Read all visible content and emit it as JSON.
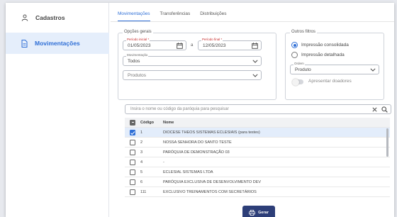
{
  "sidebar": {
    "items": [
      {
        "label": "Cadastros",
        "icon": "person-icon"
      },
      {
        "label": "Movimentações",
        "icon": "document-icon",
        "active": true
      }
    ]
  },
  "tabs": [
    {
      "label": "Movimentações",
      "active": true
    },
    {
      "label": "Transferências"
    },
    {
      "label": "Distribuições"
    }
  ],
  "general": {
    "legend": "Opções gerais",
    "start_label": "Período inicial *",
    "start_value": "01/05/2023",
    "range_sep": "a",
    "end_label": "Período final *",
    "end_value": "12/05/2023",
    "movement_label": "Movimentação",
    "movement_value": "Todos",
    "products_value": "Produtos"
  },
  "other": {
    "legend": "Outros filtros",
    "radio_consolidated": "Impressão consolidada",
    "radio_detailed": "Impressão detalhada",
    "order_label": "Ordem",
    "order_value": "Produto",
    "toggle_label": "Apresentar doadores"
  },
  "search": {
    "placeholder": "Insira o nome ou código da paróquia para pesquisar"
  },
  "table": {
    "headers": [
      "Código",
      "Nome"
    ],
    "rows": [
      {
        "code": "1",
        "name": "DIOCESE THEOS SISTEMAS ECLESIAIS (para testes)",
        "checked": true
      },
      {
        "code": "2",
        "name": "NOSSA SENHORA DO SANTO TESTE",
        "checked": false
      },
      {
        "code": "3",
        "name": "PARÓQUIA DE DEMONSTRAÇÃO 03",
        "checked": false
      },
      {
        "code": "4",
        "name": "-",
        "checked": false
      },
      {
        "code": "5",
        "name": "ECLESIAL SISTEMAS LTDA",
        "checked": false
      },
      {
        "code": "6",
        "name": "PARÓQUIA EXCLUSIVA DE DESENVOLVIMENTO DEV",
        "checked": false
      },
      {
        "code": "111",
        "name": "EXCLUSIVO TREINAMENTOS COM SECRETÁRIOS",
        "checked": false
      }
    ]
  },
  "actions": {
    "generate_label": "Gerar"
  },
  "colors": {
    "accent": "#2f6fd6",
    "button": "#2d3e78",
    "selected_row": "#e3edfb"
  }
}
